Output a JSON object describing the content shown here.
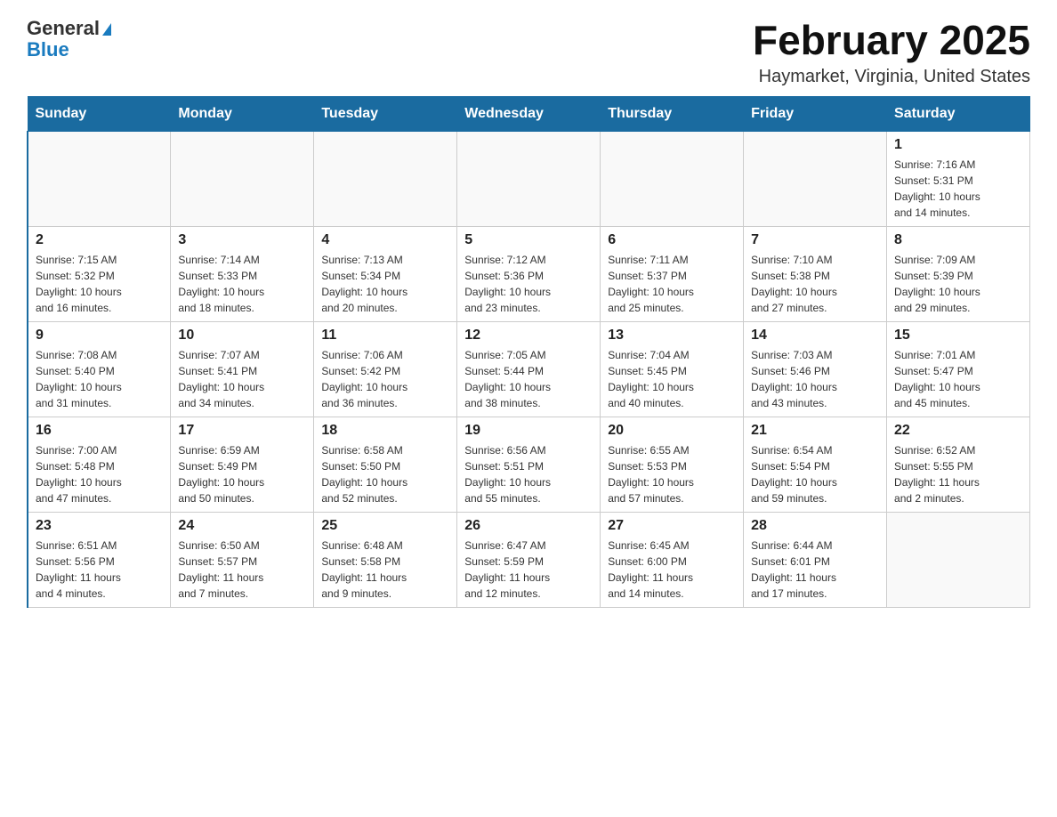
{
  "header": {
    "logo_general": "General",
    "logo_blue": "Blue",
    "month_title": "February 2025",
    "location": "Haymarket, Virginia, United States"
  },
  "weekdays": [
    "Sunday",
    "Monday",
    "Tuesday",
    "Wednesday",
    "Thursday",
    "Friday",
    "Saturday"
  ],
  "weeks": [
    [
      {
        "day": "",
        "info": ""
      },
      {
        "day": "",
        "info": ""
      },
      {
        "day": "",
        "info": ""
      },
      {
        "day": "",
        "info": ""
      },
      {
        "day": "",
        "info": ""
      },
      {
        "day": "",
        "info": ""
      },
      {
        "day": "1",
        "info": "Sunrise: 7:16 AM\nSunset: 5:31 PM\nDaylight: 10 hours\nand 14 minutes."
      }
    ],
    [
      {
        "day": "2",
        "info": "Sunrise: 7:15 AM\nSunset: 5:32 PM\nDaylight: 10 hours\nand 16 minutes."
      },
      {
        "day": "3",
        "info": "Sunrise: 7:14 AM\nSunset: 5:33 PM\nDaylight: 10 hours\nand 18 minutes."
      },
      {
        "day": "4",
        "info": "Sunrise: 7:13 AM\nSunset: 5:34 PM\nDaylight: 10 hours\nand 20 minutes."
      },
      {
        "day": "5",
        "info": "Sunrise: 7:12 AM\nSunset: 5:36 PM\nDaylight: 10 hours\nand 23 minutes."
      },
      {
        "day": "6",
        "info": "Sunrise: 7:11 AM\nSunset: 5:37 PM\nDaylight: 10 hours\nand 25 minutes."
      },
      {
        "day": "7",
        "info": "Sunrise: 7:10 AM\nSunset: 5:38 PM\nDaylight: 10 hours\nand 27 minutes."
      },
      {
        "day": "8",
        "info": "Sunrise: 7:09 AM\nSunset: 5:39 PM\nDaylight: 10 hours\nand 29 minutes."
      }
    ],
    [
      {
        "day": "9",
        "info": "Sunrise: 7:08 AM\nSunset: 5:40 PM\nDaylight: 10 hours\nand 31 minutes."
      },
      {
        "day": "10",
        "info": "Sunrise: 7:07 AM\nSunset: 5:41 PM\nDaylight: 10 hours\nand 34 minutes."
      },
      {
        "day": "11",
        "info": "Sunrise: 7:06 AM\nSunset: 5:42 PM\nDaylight: 10 hours\nand 36 minutes."
      },
      {
        "day": "12",
        "info": "Sunrise: 7:05 AM\nSunset: 5:44 PM\nDaylight: 10 hours\nand 38 minutes."
      },
      {
        "day": "13",
        "info": "Sunrise: 7:04 AM\nSunset: 5:45 PM\nDaylight: 10 hours\nand 40 minutes."
      },
      {
        "day": "14",
        "info": "Sunrise: 7:03 AM\nSunset: 5:46 PM\nDaylight: 10 hours\nand 43 minutes."
      },
      {
        "day": "15",
        "info": "Sunrise: 7:01 AM\nSunset: 5:47 PM\nDaylight: 10 hours\nand 45 minutes."
      }
    ],
    [
      {
        "day": "16",
        "info": "Sunrise: 7:00 AM\nSunset: 5:48 PM\nDaylight: 10 hours\nand 47 minutes."
      },
      {
        "day": "17",
        "info": "Sunrise: 6:59 AM\nSunset: 5:49 PM\nDaylight: 10 hours\nand 50 minutes."
      },
      {
        "day": "18",
        "info": "Sunrise: 6:58 AM\nSunset: 5:50 PM\nDaylight: 10 hours\nand 52 minutes."
      },
      {
        "day": "19",
        "info": "Sunrise: 6:56 AM\nSunset: 5:51 PM\nDaylight: 10 hours\nand 55 minutes."
      },
      {
        "day": "20",
        "info": "Sunrise: 6:55 AM\nSunset: 5:53 PM\nDaylight: 10 hours\nand 57 minutes."
      },
      {
        "day": "21",
        "info": "Sunrise: 6:54 AM\nSunset: 5:54 PM\nDaylight: 10 hours\nand 59 minutes."
      },
      {
        "day": "22",
        "info": "Sunrise: 6:52 AM\nSunset: 5:55 PM\nDaylight: 11 hours\nand 2 minutes."
      }
    ],
    [
      {
        "day": "23",
        "info": "Sunrise: 6:51 AM\nSunset: 5:56 PM\nDaylight: 11 hours\nand 4 minutes."
      },
      {
        "day": "24",
        "info": "Sunrise: 6:50 AM\nSunset: 5:57 PM\nDaylight: 11 hours\nand 7 minutes."
      },
      {
        "day": "25",
        "info": "Sunrise: 6:48 AM\nSunset: 5:58 PM\nDaylight: 11 hours\nand 9 minutes."
      },
      {
        "day": "26",
        "info": "Sunrise: 6:47 AM\nSunset: 5:59 PM\nDaylight: 11 hours\nand 12 minutes."
      },
      {
        "day": "27",
        "info": "Sunrise: 6:45 AM\nSunset: 6:00 PM\nDaylight: 11 hours\nand 14 minutes."
      },
      {
        "day": "28",
        "info": "Sunrise: 6:44 AM\nSunset: 6:01 PM\nDaylight: 11 hours\nand 17 minutes."
      },
      {
        "day": "",
        "info": ""
      }
    ]
  ]
}
